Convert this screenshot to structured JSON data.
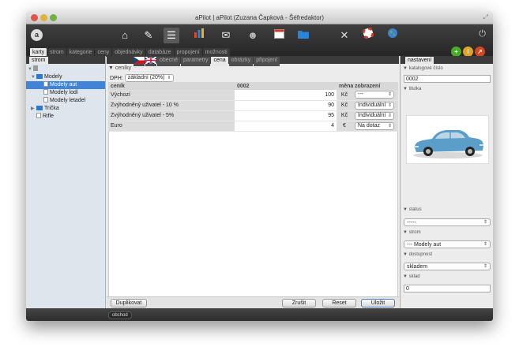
{
  "window": {
    "title": "aPilot | aPilot (Zuzana Čapková - Šéfredaktor)"
  },
  "toolbar": {
    "logo": "a",
    "icons": [
      "house-icon",
      "edit-icon",
      "list-icon",
      "chart-icon",
      "mail-icon",
      "users-icon",
      "calendar-icon",
      "folder-icon",
      "tools-icon",
      "lifebuoy-icon",
      "globe-icon"
    ],
    "power": "⏻"
  },
  "topnav": [
    "karty",
    "strom",
    "kategorie",
    "ceny",
    "objednávky",
    "databáze",
    "propojení",
    "možnosti"
  ],
  "action_circles": [
    {
      "symbol": "+",
      "color": "#4aab2a"
    },
    {
      "symbol": "i",
      "color": "#e2a321"
    },
    {
      "symbol": "↗",
      "color": "#d5461f"
    }
  ],
  "left": {
    "tab": "strom",
    "tree": [
      {
        "label": "",
        "indent": 0,
        "type": "root",
        "icon": "list-icon"
      },
      {
        "label": "Modely",
        "indent": 1,
        "type": "folder"
      },
      {
        "label": "Modely aut",
        "indent": 2,
        "type": "page",
        "selected": true
      },
      {
        "label": "Modely lodí",
        "indent": 2,
        "type": "page"
      },
      {
        "label": "Modely letadel",
        "indent": 2,
        "type": "page"
      },
      {
        "label": "Trička",
        "indent": 1,
        "type": "folder"
      },
      {
        "label": "Rifle",
        "indent": 1,
        "type": "page"
      }
    ]
  },
  "center": {
    "tabs": [
      "cz-flag",
      "uk-flag",
      "obecné",
      "parametry",
      "cena",
      "obrázky",
      "připojení"
    ],
    "active_tab": "cena",
    "section": "ceníky",
    "dph_label": "DPH:",
    "dph_value": "základní (20%)",
    "table": {
      "headers": [
        "ceník",
        "0002",
        "měna",
        "zobrazení"
      ],
      "rows": [
        {
          "name": "Výchozí",
          "value": "100",
          "currency": "Kč",
          "display": "---"
        },
        {
          "name": "Zvýhodněný uživatel - 10 %",
          "value": "90",
          "currency": "Kč",
          "display": "Individuální"
        },
        {
          "name": "Zvýhodněný uživatel - 5%",
          "value": "95",
          "currency": "Kč",
          "display": "Individuální"
        },
        {
          "name": "Euro",
          "value": "4",
          "currency": "€",
          "display": "Na dotaz"
        }
      ]
    },
    "buttons": {
      "duplicate": "Duplikovat",
      "cancel": "Zrušit",
      "reset": "Reset",
      "save": "Uložit"
    }
  },
  "right": {
    "tab": "nastavení",
    "catalog_label": "katalogové číslo",
    "catalog_value": "0002",
    "tile_label": "titulka",
    "status_label": "status",
    "status_value": "-----",
    "tree_label": "strom",
    "tree_value": "--- Modely aut",
    "availability_label": "dostupnost",
    "availability_value": "skladem",
    "stock_label": "sklad",
    "stock_value": "0"
  },
  "statusbar": {
    "label": "obchod"
  },
  "colors": {
    "selected": "#3f84d6",
    "toolbar": "#2f2f2f"
  }
}
